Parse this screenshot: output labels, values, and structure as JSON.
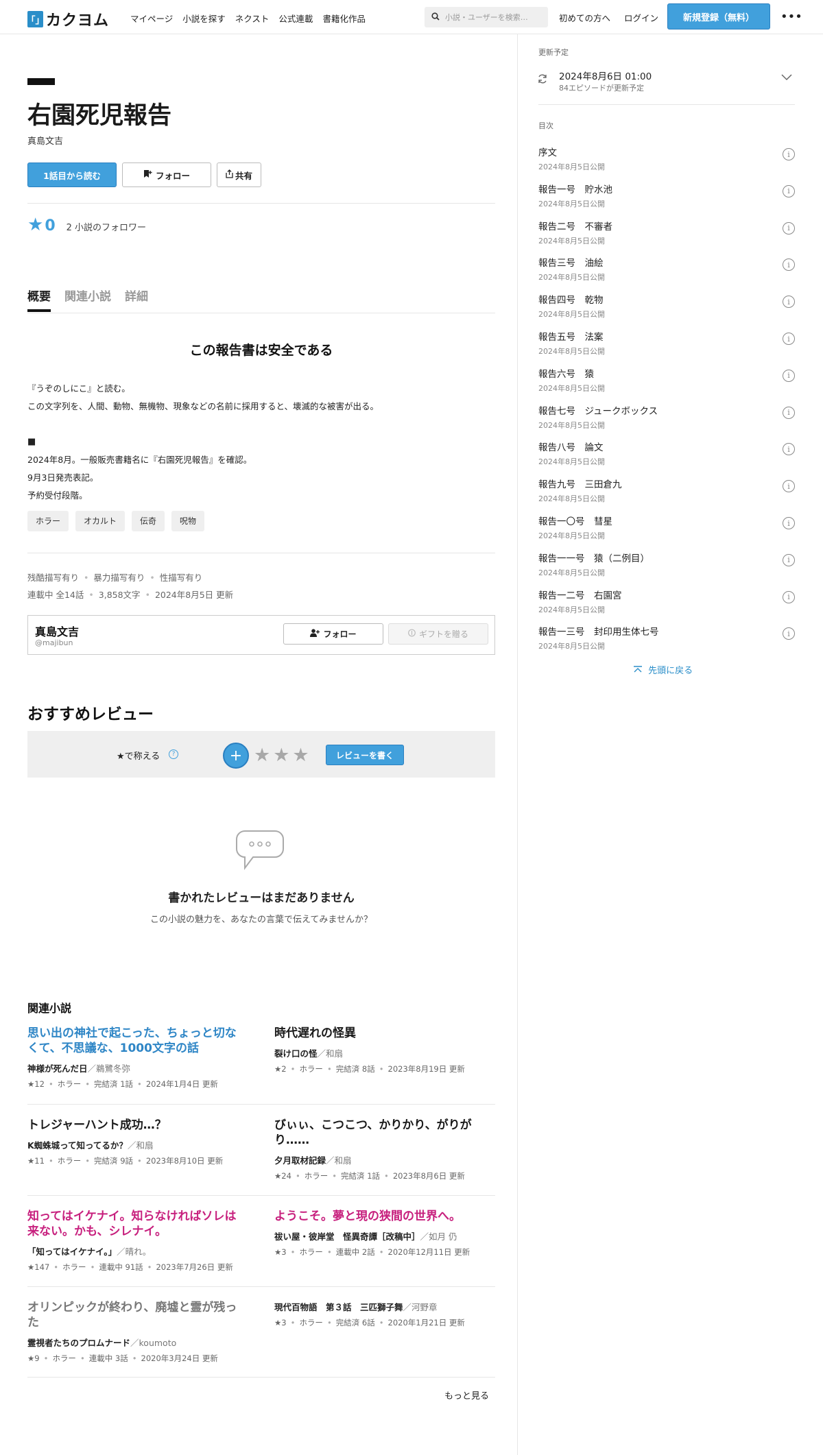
{
  "header": {
    "logo_mark": "「」",
    "logo_text": "カクヨム",
    "nav": [
      "マイページ",
      "小説を探す",
      "ネクスト",
      "公式連載",
      "書籍化作品"
    ],
    "search_placeholder": "小説・ユーザーを検索…",
    "links": [
      "初めての方へ",
      "ログイン"
    ],
    "signup": "新規登録（無料）",
    "more": "•••"
  },
  "work": {
    "title": "右園死児報告",
    "author": "真島文吉",
    "read_button": "1話目から読む",
    "follow_button": "フォロー",
    "share_button": "共有",
    "stars": "0",
    "followers": "2 小説のフォロワー"
  },
  "tabs": [
    "概要",
    "関連小説",
    "詳細"
  ],
  "catchphrase": "この報告書は安全である",
  "intro_lines": [
    "『うぞのしにこ』と読む。",
    "この文字列を、人間、動物、無機物、現象などの名前に採用すると、壊滅的な被害が出る。",
    "",
    "■",
    "2024年8月。一般販売書籍名に『右園死児報告』を確認。",
    "9月3日発売表記。",
    "予約受付段階。"
  ],
  "tags": [
    "ホラー",
    "オカルト",
    "伝奇",
    "呪物"
  ],
  "content_warnings": [
    "残酷描写有り",
    "暴力描写有り",
    "性描写有り"
  ],
  "status": [
    "連載中 全14話",
    "3,858文字",
    "2024年8月5日 更新"
  ],
  "author_box": {
    "name": "真島文吉",
    "id": "@majibun",
    "follow": "フォロー",
    "gift": "ギフトを贈る"
  },
  "reviews": {
    "title": "おすすめレビュー",
    "praise_label": "★で称える",
    "help": "?",
    "plus": "+",
    "stars": "★★★",
    "write_button": "レビューを書く",
    "empty_title": "書かれたレビューはまだありません",
    "empty_sub": "この小説の魅力を、あなたの言葉で伝えてみませんか？"
  },
  "related": {
    "title": "関連小説",
    "more": "もっと見る",
    "items": [
      {
        "title": "思い出の神社で起こった、ちょっと切なくて、不思議な、1000文字の話",
        "color": "#2f86c6",
        "work": "神様が死んだ日",
        "author": "／鵜鷺冬弥",
        "meta": [
          "★12",
          "ホラー",
          "完結済 1話",
          "2024年1月4日 更新"
        ]
      },
      {
        "title": "時代遅れの怪異",
        "color": "#1a1a1a",
        "work": "裂け口の怪",
        "author": "／和扇",
        "meta": [
          "★2",
          "ホラー",
          "完結済 8話",
          "2023年8月19日 更新"
        ]
      },
      {
        "title": "トレジャーハント成功…？",
        "color": "#1a1a1a",
        "work": "K蜘蛛城って知ってるか？",
        "author": "／和扇",
        "meta": [
          "★11",
          "ホラー",
          "完結済 9話",
          "2023年8月10日 更新"
        ]
      },
      {
        "title": "びぃぃ、こつこつ、かりかり、がりがり……",
        "color": "#1a1a1a",
        "work": "夕月取材記録",
        "author": "／和扇",
        "meta": [
          "★24",
          "ホラー",
          "完結済 1話",
          "2023年8月6日 更新"
        ]
      },
      {
        "title": "知ってはイケナイ。知らなければソレは来ない。かも、シレナイ。",
        "color": "#c71f7d",
        "work": "「知ってはイケナイ。」",
        "author": "／晴れ。",
        "meta": [
          "★147",
          "ホラー",
          "連載中 91話",
          "2023年7月26日 更新"
        ]
      },
      {
        "title": "ようこそ。夢と現の狭間の世界へ。",
        "color": "#c71f7d",
        "work": "祓い屋・彼岸堂　怪異奇譚［改稿中］",
        "author": "／如月 仍",
        "meta": [
          "★3",
          "ホラー",
          "連載中 2話",
          "2020年12月11日 更新"
        ]
      },
      {
        "title": "オリンピックが終わり、廃墟と霊が残った",
        "color": "#777777",
        "work": "霊視者たちのプロムナード",
        "author": "／koumoto",
        "meta": [
          "★9",
          "ホラー",
          "連載中 3話",
          "2020年3月24日 更新"
        ]
      },
      {
        "title": "",
        "color": "#1a1a1a",
        "work": "現代百物語　第３話　三匹獅子舞",
        "author": "／河野章",
        "meta": [
          "★3",
          "ホラー",
          "完結済 6話",
          "2020年1月21日 更新"
        ]
      }
    ]
  },
  "sidebar": {
    "update_label": "更新予定",
    "update_date": "2024年8月6日 01:00",
    "update_sub": "84エピソードが更新予定",
    "toc_label": "目次",
    "episodes": [
      {
        "title": "序文",
        "date": "2024年8月5日公開"
      },
      {
        "title": "報告一号　貯水池",
        "date": "2024年8月5日公開"
      },
      {
        "title": "報告二号　不審者",
        "date": "2024年8月5日公開"
      },
      {
        "title": "報告三号　油絵",
        "date": "2024年8月5日公開"
      },
      {
        "title": "報告四号　乾物",
        "date": "2024年8月5日公開"
      },
      {
        "title": "報告五号　法案",
        "date": "2024年8月5日公開"
      },
      {
        "title": "報告六号　猿",
        "date": "2024年8月5日公開"
      },
      {
        "title": "報告七号　ジュークボックス",
        "date": "2024年8月5日公開"
      },
      {
        "title": "報告八号　論文",
        "date": "2024年8月5日公開"
      },
      {
        "title": "報告九号　三田倉九",
        "date": "2024年8月5日公開"
      },
      {
        "title": "報告一〇号　彗星",
        "date": "2024年8月5日公開"
      },
      {
        "title": "報告一一号　猿（二例目）",
        "date": "2024年8月5日公開"
      },
      {
        "title": "報告一二号　右園宮",
        "date": "2024年8月5日公開"
      },
      {
        "title": "報告一三号　封印用生体七号",
        "date": "2024年8月5日公開"
      }
    ],
    "back_to_top": "先頭に戻る"
  }
}
